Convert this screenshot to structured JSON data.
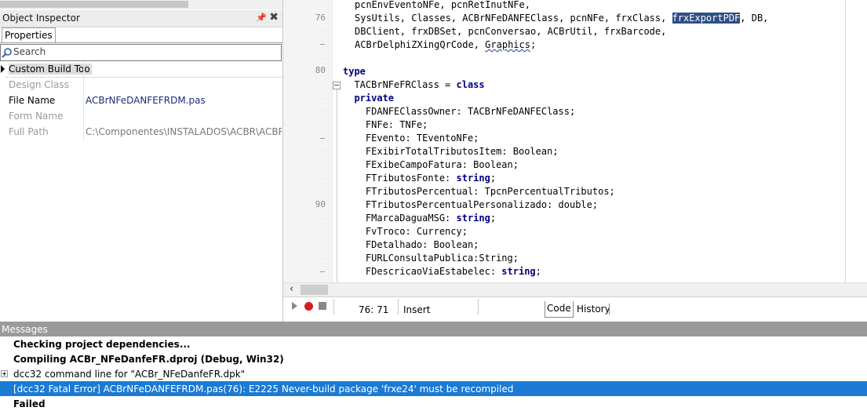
{
  "object_inspector": {
    "title": "Object Inspector",
    "tab_properties": "Properties",
    "search_placeholder": "Search",
    "rows": [
      {
        "name": "Custom Build Too",
        "value": ""
      },
      {
        "name": "Design Class",
        "value": ""
      },
      {
        "name": "File Name",
        "value": "ACBrNFeDANFEFRDM.pas"
      },
      {
        "name": "Form Name",
        "value": ""
      },
      {
        "name": "Full Path",
        "value": "C:\\Componentes\\INSTALADOS\\ACBR\\ACBR\\Fo"
      }
    ]
  },
  "editor": {
    "line_numbers": {
      "l76": "76",
      "l80": "80",
      "l90": "90"
    },
    "lines": {
      "c0": "pcnEnvEventoNFe, pcnRetInutNFe,",
      "c1a": "SysUtils, Classes, ACBrNFeDANFEClass, pcnNFe, frxClass, ",
      "c1sel": "frxExportPDF",
      "c1b": ", DB,",
      "c2": "DBClient, frxDBSet, pcnConversao, ACBrUtil, frxBarcode,",
      "c3a": "ACBrDelphiZXingQrCode, ",
      "c3b": "Graphics",
      "c3c": ";",
      "c4": "type",
      "c5a": "  TACBrNFeFRClass = ",
      "c5b": "class",
      "c6": "  private",
      "c7": "    FDANFEClassOwner: TACBrNFeDANFEClass;",
      "c8": "    FNFe: TNFe;",
      "c9": "    FEvento: TEventoNFe;",
      "c10": "    FExibirTotalTributosItem: Boolean;",
      "c11": "    FExibeCampoFatura: Boolean;",
      "c12a": "    FTributosFonte: ",
      "c12b": "string",
      "c12c": ";",
      "c13": "    FTributosPercentual: TpcnPercentualTributos;",
      "c14": "    FTributosPercentualPersonalizado: double;",
      "c15a": "    FMarcaDaguaMSG: ",
      "c15b": "string",
      "c15c": ";",
      "c16": "    FvTroco: Currency;",
      "c17": "    FDetalhado: Boolean;",
      "c18": "    FURLConsultaPublica:String;",
      "c19a": "    FDescricaoViaEstabelec: ",
      "c19b": "string",
      "c19c": ";"
    },
    "status": {
      "position": "76: 71",
      "mode": "Insert",
      "tab_code": "Code",
      "tab_history": "History"
    }
  },
  "messages": {
    "title": "Messages",
    "items": [
      {
        "text": "Checking project dependencies..."
      },
      {
        "text": "Compiling ACBr_NFeDanfeFR.dproj (Debug, Win32)"
      },
      {
        "text": "dcc32 command line for \"ACBr_NFeDanfeFR.dpk\""
      },
      {
        "text": "[dcc32 Fatal Error] ACBrNFeDANFEFRDM.pas(76): E2225 Never-build package 'frxe24' must be recompiled"
      },
      {
        "text": "Failed"
      }
    ]
  }
}
